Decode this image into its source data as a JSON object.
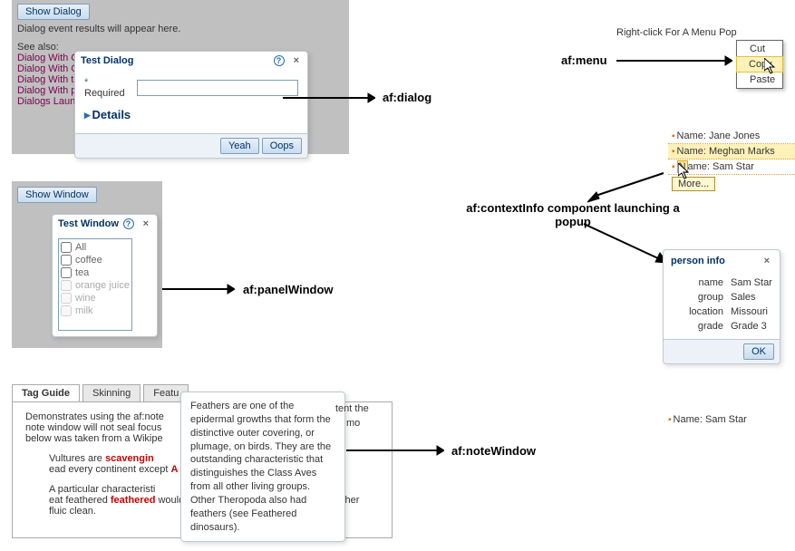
{
  "top_gray": {
    "show_dialog_btn": "Show Dialog",
    "results_text": "Dialog event results will appear here.",
    "see_also": "See also:",
    "links": [
      "Dialog With Cu",
      "Dialog With Cu",
      "Dialog With ta",
      "Dialog With pa",
      "Dialogs Launch"
    ]
  },
  "dialog": {
    "title": "Test Dialog",
    "required_label": "Required",
    "details": "Details",
    "yeah": "Yeah",
    "oops": "Oops"
  },
  "labels": {
    "af_dialog": "af:dialog",
    "af_menu": "af:menu",
    "af_panelWindow": "af:panelWindow",
    "af_noteWindow": "af:noteWindow",
    "context_info": "af:contextInfo component launching a popup"
  },
  "menu_caption": "Right-click For A Menu Pop",
  "menu": {
    "cut": "Cut",
    "copy": "Copy",
    "paste": "Paste"
  },
  "show_window_btn": "Show Window",
  "panel_window": {
    "title": "Test Window",
    "items": [
      "All",
      "coffee",
      "tea",
      "orange juice",
      "wine",
      "milk"
    ]
  },
  "name_list": {
    "r1": "Name: Jane Jones",
    "r2": "Name: Meghan Marks",
    "r3_a": "N",
    "r3_b": "ame: Sam Star",
    "more": "More..."
  },
  "person_info": {
    "title": "person info",
    "rows": [
      {
        "lbl": "name",
        "val": "Sam Star"
      },
      {
        "lbl": "group",
        "val": "Sales"
      },
      {
        "lbl": "location",
        "val": "Missouri"
      },
      {
        "lbl": "grade",
        "val": "Grade 3"
      }
    ],
    "ok": "OK",
    "below": "Name: Sam Star"
  },
  "tabs": [
    "Tag Guide",
    "Skinning",
    "Featu"
  ],
  "tab_content": {
    "p1a": "Demonstrates using the af:note",
    "p1b": "note window will not seal focus",
    "p1c": "below was taken from a Wikipe",
    "p1d": "tent the ",
    "p2a": "Vultures are ",
    "p2b": "scavengin",
    "p2c": "ead every continent except ",
    "p2d": "A",
    "p3a": "A particular characteristi",
    "p3b": "eat feathered ",
    "p3c": "feathered",
    "p3d": " would become spattered with blood and other fluic clean."
  },
  "note_window": "Feathers are one of the epidermal growths that form the distinctive outer covering, or plumage, on birds. They are the outstanding characteristic that distinguishes the Class Aves from all other living groups. Other Theropoda also had feathers (see Feathered dinosaurs)."
}
